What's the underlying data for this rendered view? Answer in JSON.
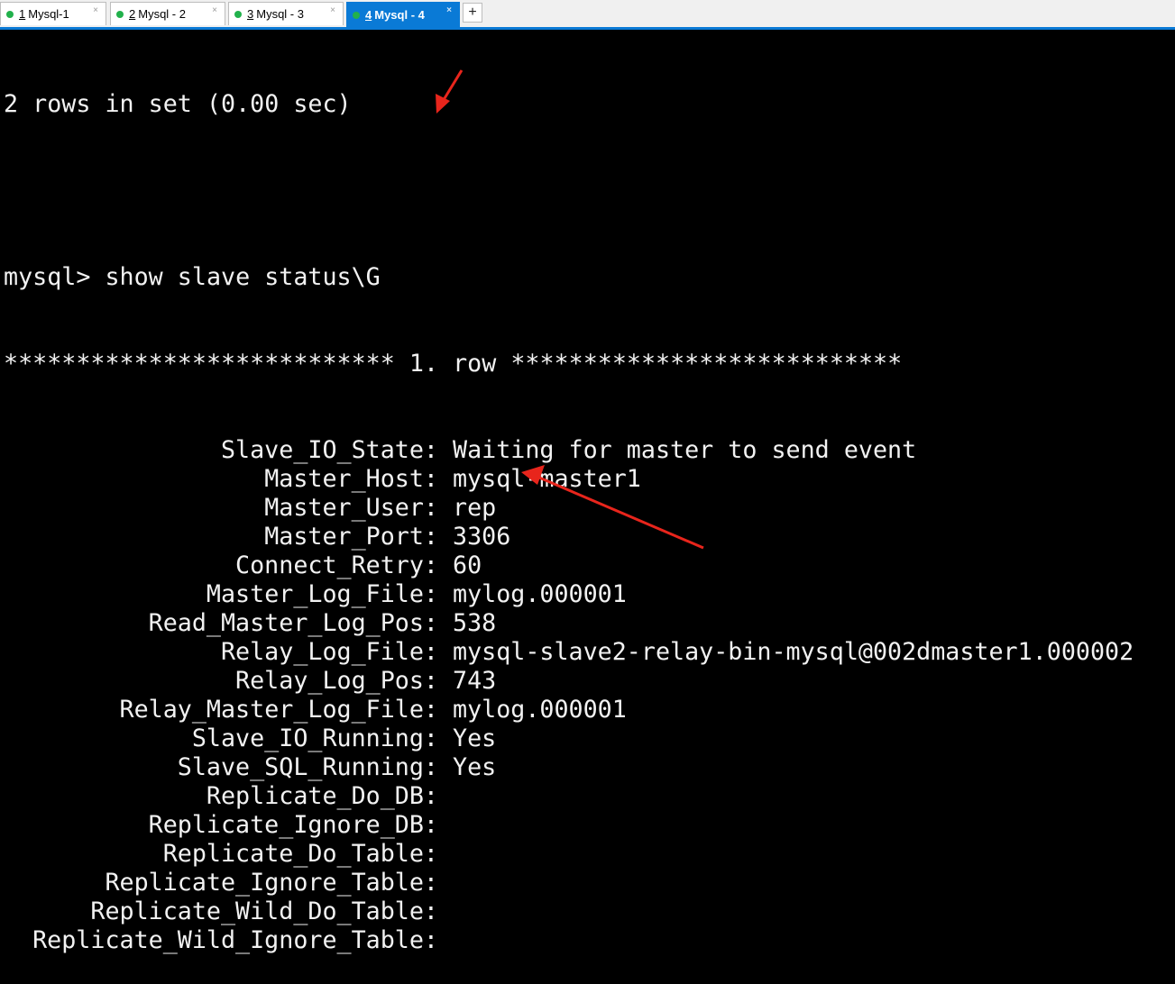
{
  "tabs": [
    {
      "num": "1",
      "label": "Mysql-1",
      "active": false
    },
    {
      "num": "2",
      "label": "Mysql - 2",
      "active": false
    },
    {
      "num": "3",
      "label": "Mysql - 3",
      "active": false
    },
    {
      "num": "4",
      "label": "Mysql - 4",
      "active": true
    }
  ],
  "new_tab_symbol": "+",
  "close_symbol": "×",
  "terminal": {
    "rows_line": "2 rows in set (0.00 sec)",
    "prompt_line": "mysql> show slave status\\G",
    "row_header": "*************************** 1. row ***************************",
    "fields": [
      {
        "key": "Slave_IO_State:",
        "value": "Waiting for master to send event"
      },
      {
        "key": "Master_Host:",
        "value": "mysql-master1"
      },
      {
        "key": "Master_User:",
        "value": "rep"
      },
      {
        "key": "Master_Port:",
        "value": "3306"
      },
      {
        "key": "Connect_Retry:",
        "value": "60"
      },
      {
        "key": "Master_Log_File:",
        "value": "mylog.000001"
      },
      {
        "key": "Read_Master_Log_Pos:",
        "value": "538"
      },
      {
        "key": "Relay_Log_File:",
        "value": "mysql-slave2-relay-bin-mysql@002dmaster1.000002"
      },
      {
        "key": "Relay_Log_Pos:",
        "value": "743"
      },
      {
        "key": "Relay_Master_Log_File:",
        "value": "mylog.000001"
      },
      {
        "key": "Slave_IO_Running:",
        "value": "Yes"
      },
      {
        "key": "Slave_SQL_Running:",
        "value": "Yes"
      },
      {
        "key": "Replicate_Do_DB:",
        "value": ""
      },
      {
        "key": "Replicate_Ignore_DB:",
        "value": ""
      },
      {
        "key": "Replicate_Do_Table:",
        "value": ""
      },
      {
        "key": "Replicate_Ignore_Table:",
        "value": ""
      },
      {
        "key": "Replicate_Wild_Do_Table:",
        "value": ""
      },
      {
        "key": "Replicate_Wild_Ignore_Table:",
        "value": ""
      }
    ]
  },
  "colors": {
    "background": "#000000",
    "text": "#f2f2f2",
    "accent": "#0a7ad6",
    "status_dot": "#22b14c",
    "annotation_arrow": "#e8251c"
  }
}
